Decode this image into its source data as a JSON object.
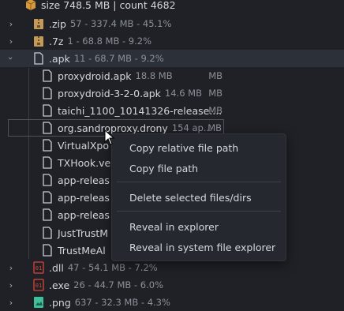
{
  "header": {
    "text": "size 748.5 MB | count 4682"
  },
  "rows": [
    {
      "name": ".zip",
      "meta": "57 - 337.4 MB - 45.1%"
    },
    {
      "name": ".7z",
      "meta": "1 - 68.8 MB - 9.2%"
    },
    {
      "name": ".apk",
      "meta": "11 - 68.7 MB - 9.2%"
    },
    {
      "name": "proxydroid.apk",
      "meta": "18.8 MB"
    },
    {
      "name": "proxydroid-3-2-0.apk",
      "meta": "14.6 MB",
      "mb": "MB"
    },
    {
      "name": "taichi_1100_10141326-release....",
      "mb": "MB"
    },
    {
      "name": "org.sandroproxy.drony",
      "meta": "154 ap...",
      "mb": "MB"
    },
    {
      "name": "VirtualXpo"
    },
    {
      "name": "TXHook.ve"
    },
    {
      "name": "app-releas"
    },
    {
      "name": "app-releas"
    },
    {
      "name": "app-releas"
    },
    {
      "name": "JustTrustM"
    },
    {
      "name": "TrustMeAl"
    },
    {
      "name": ".dll",
      "meta": "47 - 54.1 MB - 7.2%"
    },
    {
      "name": ".exe",
      "meta": "26 - 44.7 MB - 6.0%"
    },
    {
      "name": ".png",
      "meta": "637 - 32.3 MB - 4.3%"
    }
  ],
  "menu": {
    "copy_relative": "Copy relative file path",
    "copy_path": "Copy file path",
    "delete": "Delete selected files/dirs",
    "reveal": "Reveal in explorer",
    "reveal_system": "Reveal in system file explorer"
  },
  "colors": {
    "background": "#1f2126",
    "folder": "#c49a5a",
    "selected": "#2c3038",
    "dll_icon": "#d9443a",
    "png_icon": "#3fbf9a"
  },
  "icons": {
    "header": "package-icon",
    "zip": "zip-folder-icon",
    "7z": "zip-folder-icon",
    "apk": "file-icon",
    "dll": "binary-file-icon",
    "exe": "binary-file-icon",
    "png": "image-file-icon"
  }
}
